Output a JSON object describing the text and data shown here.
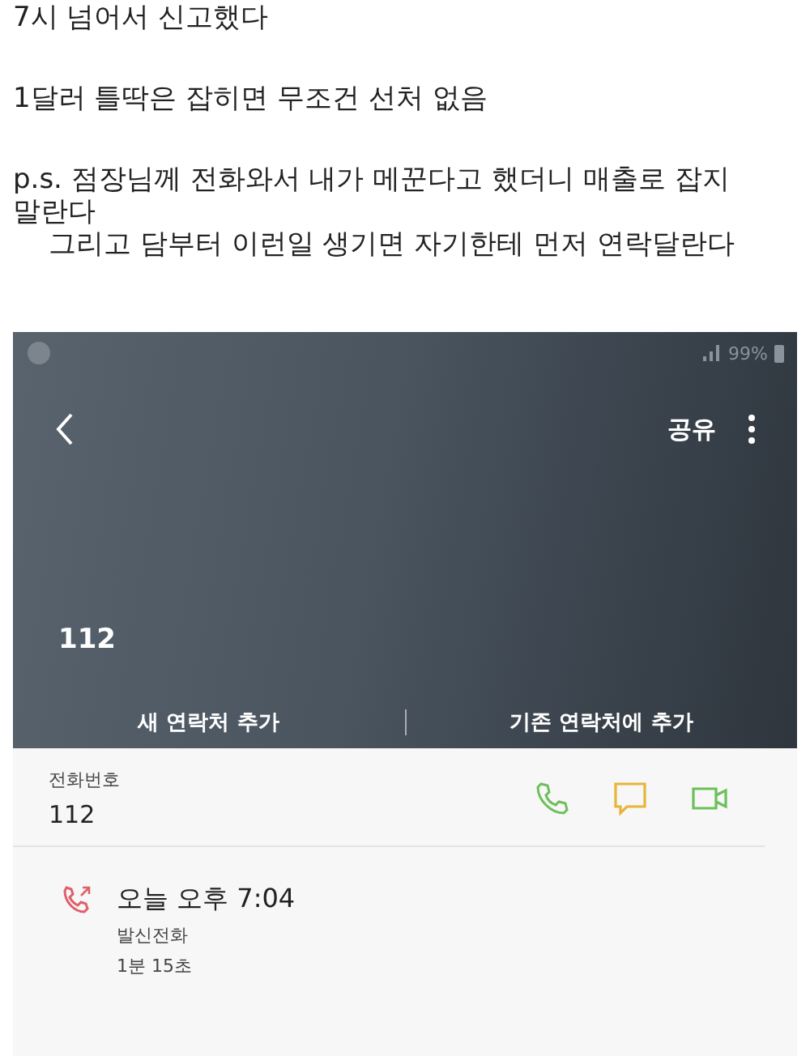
{
  "post": {
    "lines": [
      {
        "text": "7시 넘어서 신고했다",
        "indent": false
      },
      {
        "text": "1달러 틀딱은 잡히면 무조건 선처 없음",
        "indent": false
      },
      {
        "text": "p.s. 점장님께 전화와서 내가 메꾼다고 했더니 매출로 잡지 말란다",
        "indent": false
      },
      {
        "text": "그리고 담부터 이런일 생기면 자기한테 먼저 연락달란다",
        "indent": true
      }
    ]
  },
  "phone": {
    "status_bar": {
      "battery": "99%"
    },
    "header": {
      "share": "공유",
      "number": "112",
      "actions": [
        "새 연락처 추가",
        "기존 연락처에 추가"
      ]
    },
    "detail": {
      "label": "전화번호",
      "number": "112"
    },
    "call_log": [
      {
        "time": "오늘 오후 7:04",
        "type": "발신전화",
        "duration": "1분 15초"
      }
    ]
  }
}
